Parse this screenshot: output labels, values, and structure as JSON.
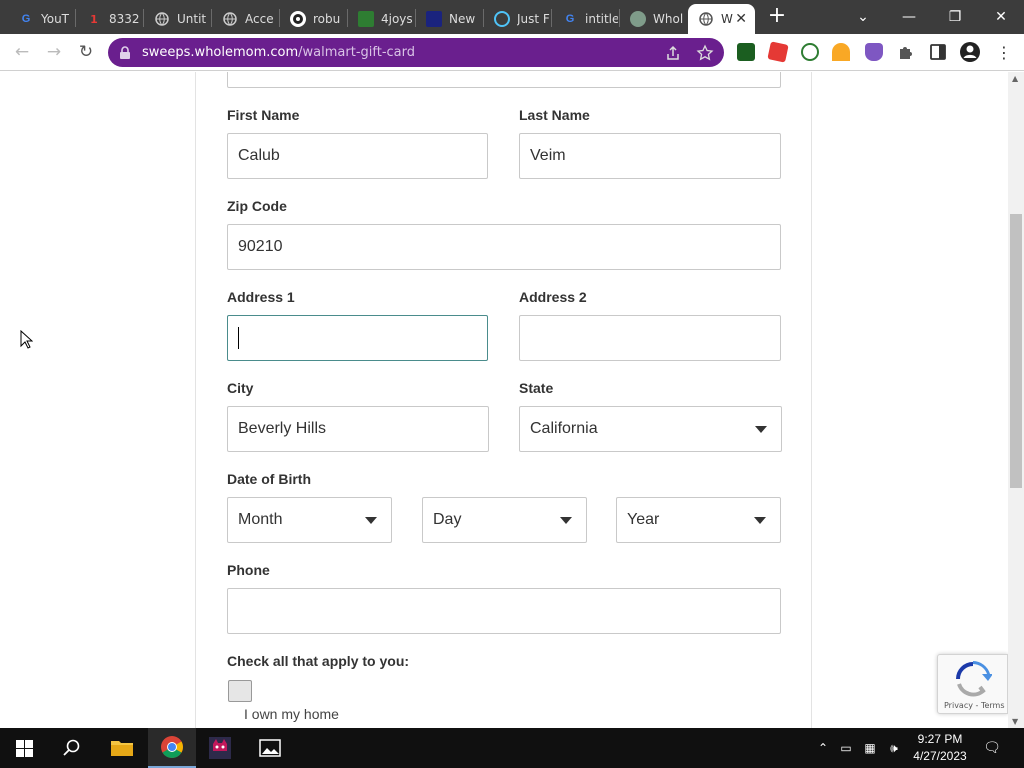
{
  "browser": {
    "tabs": [
      {
        "title": "YouT",
        "icon": "google-icon"
      },
      {
        "title": "8332",
        "icon": "number-icon",
        "icon_text": "1"
      },
      {
        "title": "Untit",
        "icon": "globe-icon"
      },
      {
        "title": "Acce",
        "icon": "globe-icon"
      },
      {
        "title": "robu",
        "icon": "robux-icon"
      },
      {
        "title": "4joys",
        "icon": "4joys-icon"
      },
      {
        "title": "New",
        "icon": "news-icon"
      },
      {
        "title": "Just F",
        "icon": "justfor-icon"
      },
      {
        "title": "intitle",
        "icon": "google-icon"
      },
      {
        "title": "Whol",
        "icon": "wholemom-icon"
      },
      {
        "title": "W",
        "icon": "globe-icon",
        "active": true
      }
    ],
    "url_host": "sweeps.wholemom.com",
    "url_path": "/walmart-gift-card"
  },
  "form": {
    "first_name": {
      "label": "First Name",
      "value": "Calub"
    },
    "last_name": {
      "label": "Last Name",
      "value": "Veim"
    },
    "zip": {
      "label": "Zip Code",
      "value": "90210"
    },
    "address1": {
      "label": "Address 1",
      "value": ""
    },
    "address2": {
      "label": "Address 2",
      "value": ""
    },
    "city": {
      "label": "City",
      "value": "Beverly Hills"
    },
    "state": {
      "label": "State",
      "selected": "California"
    },
    "dob": {
      "label": "Date of Birth",
      "month": "Month",
      "day": "Day",
      "year": "Year"
    },
    "phone": {
      "label": "Phone",
      "value": ""
    },
    "checks": {
      "heading": "Check all that apply to you:",
      "own_home": "I own my home"
    }
  },
  "recaptcha": {
    "links": "Privacy - Terms"
  },
  "taskbar": {
    "time": "9:27 PM",
    "date": "4/27/2023"
  },
  "colors": {
    "omnibox": "#6a1f8e",
    "tabstrip": "#3c3c3c",
    "focus_border": "#4a8c8c"
  }
}
